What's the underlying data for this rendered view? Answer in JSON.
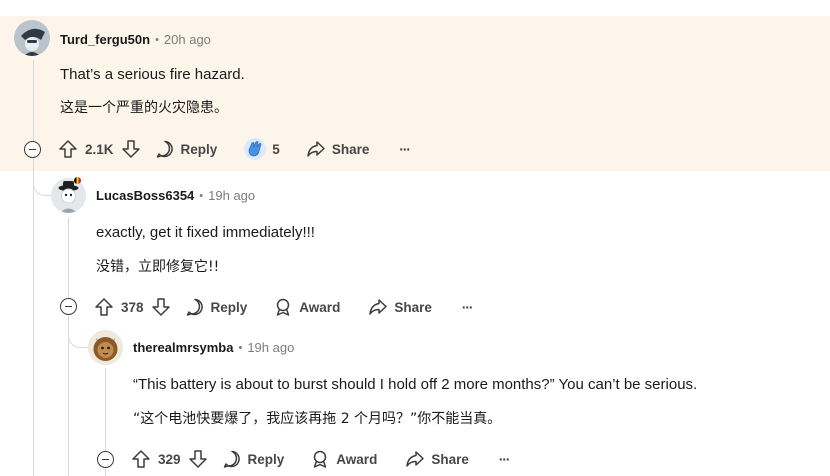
{
  "comments": [
    {
      "username": "Turd_fergu50n",
      "time": "20h ago",
      "text_en": "That’s a serious fire hazard.",
      "text_zh": "这是一个严重的火灾隐患。",
      "votes": "2.1K",
      "reply_label": "Reply",
      "award_count": "5",
      "share_label": "Share",
      "more_label": "···"
    },
    {
      "username": "LucasBoss6354",
      "time": "19h ago",
      "text_en": "exactly, get it fixed immediately!!!",
      "text_zh": "没错，立即修复它!!",
      "votes": "378",
      "reply_label": "Reply",
      "award_label": "Award",
      "share_label": "Share",
      "more_label": "···"
    },
    {
      "username": "therealmrsymba",
      "time": "19h ago",
      "text_en": "“This battery is about to burst should I hold off 2 more months?” You can’t be serious.",
      "text_zh": "“这个电池快要爆了，我应该再拖 2 个月吗？”你不能当真。",
      "votes": "329",
      "reply_label": "Reply",
      "award_label": "Award",
      "share_label": "Share",
      "more_label": "···"
    }
  ],
  "separator": "•",
  "colors": {
    "highlight": "#fdf5ea",
    "thread_line": "#d7dadc",
    "award_blue": "#4a8fe0"
  },
  "icons": [
    "upvote-icon",
    "downvote-icon",
    "reply-icon",
    "award-icon",
    "share-icon",
    "more-icon",
    "collapse-icon",
    "clapping-award-icon"
  ]
}
